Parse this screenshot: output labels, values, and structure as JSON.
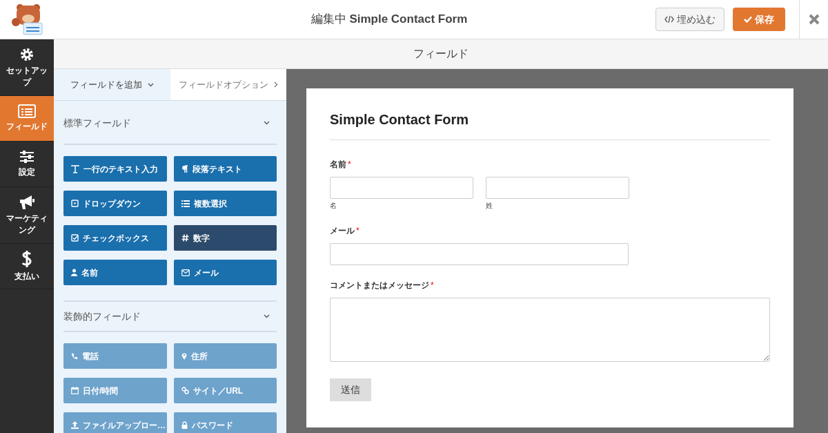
{
  "header": {
    "title": "編集中 **Simple Contact Form**",
    "embed_button": "埋め込む",
    "save_button": "保存"
  },
  "sidebar": {
    "items": [
      {
        "label": "セットアップ",
        "selected": false
      },
      {
        "label": "フィールド",
        "selected": true
      },
      {
        "label": "設定",
        "selected": false
      },
      {
        "label": "マーケティング",
        "selected": false
      },
      {
        "label": "支払い",
        "selected": false
      }
    ]
  },
  "subheader": {
    "title": "フィールド"
  },
  "tabs": [
    {
      "label": "フィールドを追加",
      "selected": true
    },
    {
      "label": "フィールドオプション",
      "selected": false
    }
  ],
  "sections": [
    {
      "title": "標準フィールド",
      "kind": "standard",
      "buttons": [
        {
          "label": "一行のテキスト入力",
          "highlighted": false
        },
        {
          "label": "段落テキスト",
          "highlighted": false
        },
        {
          "label": "ドロップダウン",
          "highlighted": false
        },
        {
          "label": "複数選択",
          "highlighted": false
        },
        {
          "label": "チェックボックス",
          "highlighted": false
        },
        {
          "label": "数字",
          "highlighted": true
        },
        {
          "label": "名前",
          "highlighted": false
        },
        {
          "label": "メール",
          "highlighted": false
        }
      ]
    },
    {
      "title": "装飾的フィールド",
      "kind": "fancy",
      "buttons": [
        {
          "label": "電話",
          "highlighted": false
        },
        {
          "label": "住所",
          "highlighted": false
        },
        {
          "label": "日付/時間",
          "highlighted": false
        },
        {
          "label": "サイト／URL",
          "highlighted": false
        },
        {
          "label": "ファイルアップロー…",
          "highlighted": false
        },
        {
          "label": "パスワード",
          "highlighted": false
        }
      ]
    }
  ],
  "form": {
    "title": "Simple Contact Form",
    "fields": [
      {
        "kind": "name",
        "label": "名前",
        "required_mark": "*",
        "sublabels": [
          "名",
          "姓"
        ]
      },
      {
        "kind": "email",
        "label": "メール",
        "required_mark": "*"
      },
      {
        "kind": "textarea",
        "label": "コメントまたはメッセージ",
        "required_mark": "*"
      }
    ],
    "submit": "送信"
  }
}
